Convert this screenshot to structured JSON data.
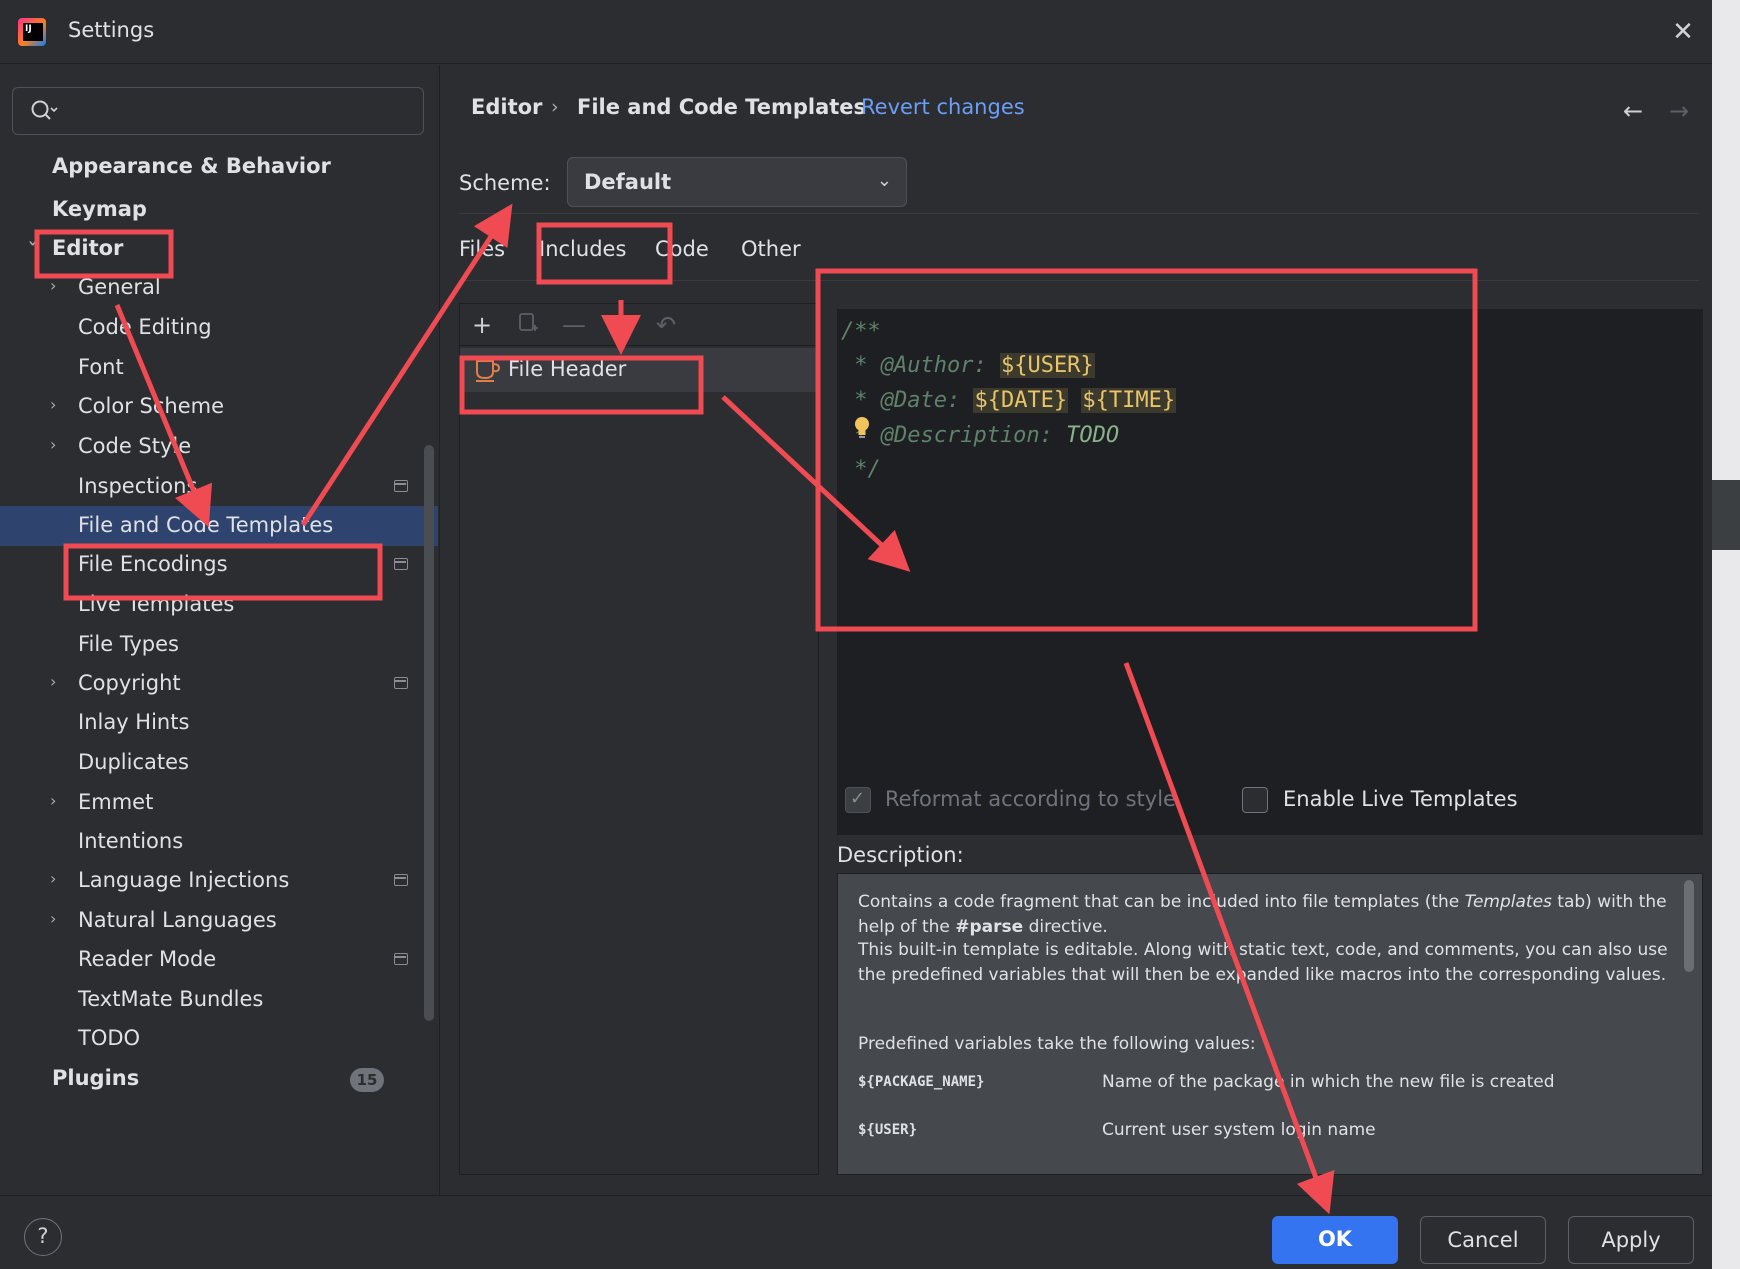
{
  "window": {
    "title": "Settings"
  },
  "search": {
    "placeholder": "",
    "value": ""
  },
  "sidebar": {
    "items": [
      {
        "label": "Appearance & Behavior"
      },
      {
        "label": "Keymap"
      },
      {
        "label": "Editor"
      },
      {
        "label": "General"
      },
      {
        "label": "Code Editing"
      },
      {
        "label": "Font"
      },
      {
        "label": "Color Scheme"
      },
      {
        "label": "Code Style"
      },
      {
        "label": "Inspections"
      },
      {
        "label": "File and Code Templates"
      },
      {
        "label": "File Encodings"
      },
      {
        "label": "Live Templates"
      },
      {
        "label": "File Types"
      },
      {
        "label": "Copyright"
      },
      {
        "label": "Inlay Hints"
      },
      {
        "label": "Duplicates"
      },
      {
        "label": "Emmet"
      },
      {
        "label": "Intentions"
      },
      {
        "label": "Language Injections"
      },
      {
        "label": "Natural Languages"
      },
      {
        "label": "Reader Mode"
      },
      {
        "label": "TextMate Bundles"
      },
      {
        "label": "TODO"
      },
      {
        "label": "Plugins"
      }
    ],
    "plugins_badge": "15"
  },
  "header": {
    "breadcrumb_parent": "Editor",
    "breadcrumb_sep": "›",
    "breadcrumb_current": "File and Code Templates",
    "revert_label": "Revert changes",
    "back_icon": "arrow-left-icon",
    "forward_icon": "arrow-right-icon"
  },
  "scheme": {
    "label": "Scheme:",
    "value": "Default"
  },
  "tabs": [
    {
      "label": "Files"
    },
    {
      "label": "Includes",
      "selected": true
    },
    {
      "label": "Code"
    },
    {
      "label": "Other"
    }
  ],
  "templates": {
    "toolbar_icons": [
      "add-icon",
      "copy-icon",
      "remove-icon",
      "delete-icon",
      "revert-icon"
    ],
    "items": [
      {
        "label": "File Header"
      }
    ]
  },
  "editor": {
    "lines": [
      {
        "text": "/**"
      },
      {
        "prefix": " * @Author: ",
        "vars": [
          "${USER}"
        ]
      },
      {
        "prefix": " * @Date: ",
        "vars": [
          "${DATE}",
          "${TIME}"
        ]
      },
      {
        "prefix": " * @Description: ",
        "todo": "TODO"
      },
      {
        "text": " */"
      }
    ]
  },
  "options": {
    "reformat_label": "Reformat according to style",
    "reformat_checked": true,
    "reformat_enabled": false,
    "live_templates_label": "Enable Live Templates",
    "live_templates_checked": false
  },
  "description": {
    "label": "Description:",
    "p1_a": "Contains a code fragment that can be included into file templates (the ",
    "p1_em": "Templates",
    "p1_b": " tab) with the help of the ",
    "p1_strong": "#parse",
    "p1_c": " directive.",
    "p2": "This built-in template is editable. Along with static text, code, and comments, you can also use the predefined variables that will then be expanded like macros into the corresponding values.",
    "p3": "Predefined variables take the following values:",
    "vars": [
      {
        "name": "${PACKAGE_NAME}",
        "desc": "Name of the package in which the new file is created"
      },
      {
        "name": "${USER}",
        "desc": "Current user system login name"
      }
    ]
  },
  "buttons": {
    "help": "?",
    "ok": "OK",
    "cancel": "Cancel",
    "apply": "Apply"
  },
  "annotation_color": "#f04a52"
}
